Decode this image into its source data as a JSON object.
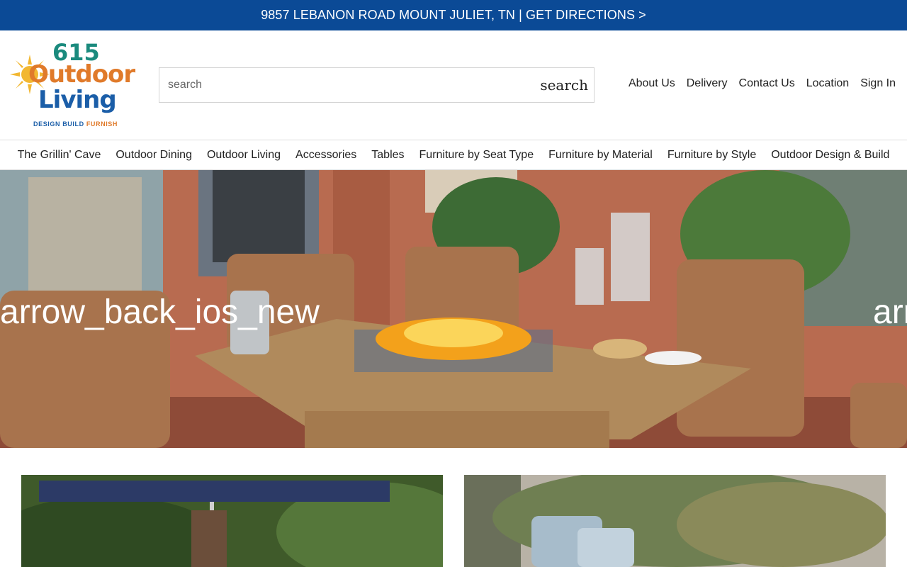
{
  "topbar": {
    "text": "9857 LEBANON ROAD MOUNT JULIET, TN | GET DIRECTIONS >"
  },
  "logo": {
    "number": "615",
    "line1": "Outdoor",
    "line2": "Living",
    "tag_a": "DESIGN BUILD ",
    "tag_b": "FURNISH"
  },
  "search": {
    "placeholder": "search",
    "button_label": "search"
  },
  "util_nav": [
    "About Us",
    "Delivery",
    "Contact Us",
    "Location",
    "Sign In"
  ],
  "categories": [
    "The Grillin' Cave",
    "Outdoor Dining",
    "Outdoor Living",
    "Accessories",
    "Tables",
    "Furniture by Seat Type",
    "Furniture by Material",
    "Furniture by Style",
    "Outdoor Design & Build"
  ],
  "hero": {
    "prev_label": "arrow_back_ios_new",
    "next_label": "arrow_forward_ios"
  },
  "colors": {
    "brand_blue": "#0b4a96",
    "logo_teal": "#1a8a7d",
    "logo_orange": "#e07a2a",
    "logo_blue": "#1b5ea8"
  }
}
